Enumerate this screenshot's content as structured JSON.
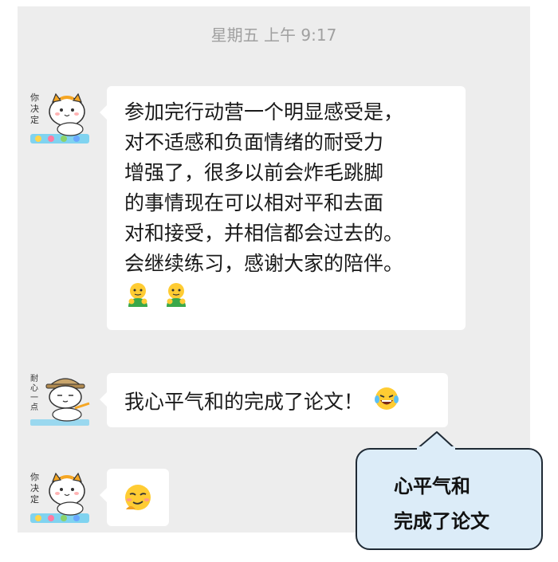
{
  "chat": {
    "timestamp": "星期五 上午 9:17",
    "messages": [
      {
        "avatar_icon": "cat-avatar-decide-icon",
        "avatar_text": [
          "你",
          "决",
          "定"
        ],
        "lines": [
          "参加完行动营一个明显感受是，",
          "对不适感和负面情绪的耐受力",
          "增强了，很多以前会炸毛跳脚",
          "的事情现在可以相对平和去面",
          "对和接受，并相信都会过去的。",
          "会继续练习，感谢大家的陪伴。"
        ],
        "emojis": [
          "hug-emoji-icon",
          "hug-emoji-icon"
        ]
      },
      {
        "avatar_icon": "cat-avatar-patience-icon",
        "avatar_text": [
          "耐",
          "心",
          "一",
          "点"
        ],
        "text": "我心平气和的完成了论文！",
        "emoji": "laughing-tears-emoji-icon"
      },
      {
        "avatar_icon": "cat-avatar-decide-icon",
        "avatar_text": [
          "你",
          "决",
          "定"
        ],
        "emoji": "smirk-emoji-icon"
      }
    ]
  },
  "callout": {
    "line1": "心平气和",
    "line2": "完成了论文"
  },
  "colors": {
    "chat_bg": "#ededed",
    "bubble_bg": "#ffffff",
    "callout_bg": "#dcecf8",
    "callout_border": "#1f2a35"
  }
}
